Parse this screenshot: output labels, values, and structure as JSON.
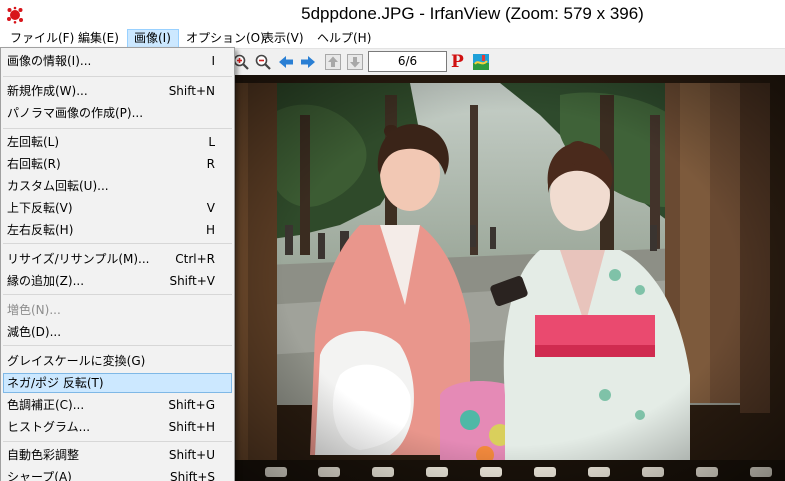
{
  "window": {
    "title": "5dppdone.JPG - IrfanView (Zoom: 579 x 396)"
  },
  "menubar": {
    "items": [
      {
        "label": "ファイル(F)"
      },
      {
        "label": "編集(E)"
      },
      {
        "label": "画像(I)"
      },
      {
        "label": "オプション(O)"
      },
      {
        "label": "表示(V)"
      },
      {
        "label": "ヘルプ(H)"
      }
    ],
    "active_index": 2
  },
  "toolbar": {
    "page_counter": "6/6",
    "p_label": "P",
    "icons": [
      "zoom-in-icon",
      "zoom-out-icon",
      "arrow-left-icon",
      "arrow-right-icon",
      "arrow-up-disabled-icon",
      "arrow-down-disabled-icon",
      "paint-icon"
    ]
  },
  "image_menu": {
    "items": [
      {
        "label": "画像の情報(I)...",
        "shortcut": "I"
      },
      {
        "label": "新規作成(W)...",
        "shortcut": "Shift+N"
      },
      {
        "label": "パノラマ画像の作成(P)...",
        "shortcut": ""
      },
      {
        "label": "左回転(L)",
        "shortcut": "L"
      },
      {
        "label": "右回転(R)",
        "shortcut": "R"
      },
      {
        "label": "カスタム回転(U)...",
        "shortcut": ""
      },
      {
        "label": "上下反転(V)",
        "shortcut": "V"
      },
      {
        "label": "左右反転(H)",
        "shortcut": "H"
      },
      {
        "label": "リサイズ/リサンプル(M)...",
        "shortcut": "Ctrl+R"
      },
      {
        "label": "縁の追加(Z)...",
        "shortcut": "Shift+V"
      },
      {
        "label": "増色(N)...",
        "shortcut": "",
        "disabled": true
      },
      {
        "label": "減色(D)...",
        "shortcut": ""
      },
      {
        "label": "グレイスケールに変換(G)",
        "shortcut": ""
      },
      {
        "label": "ネガ/ポジ 反転(T)",
        "shortcut": "",
        "highlighted": true
      },
      {
        "label": "色調補正(C)...",
        "shortcut": "Shift+G"
      },
      {
        "label": "ヒストグラム...",
        "shortcut": "Shift+H"
      },
      {
        "label": "自動色彩調整",
        "shortcut": "Shift+U"
      },
      {
        "label": "シャープ(A)",
        "shortcut": "Shift+S"
      }
    ]
  },
  "colors": {
    "menu_highlight": "#cce8ff",
    "menu_highlight_border": "#7fb8e6",
    "arrow_blue": "#2a7fd4",
    "p_red": "#d01010"
  }
}
